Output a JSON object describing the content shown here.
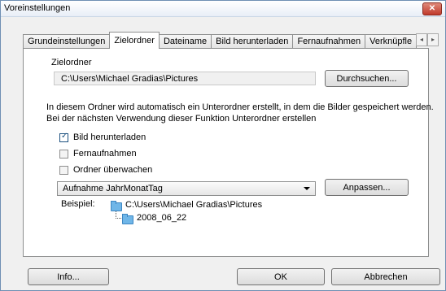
{
  "window": {
    "title": "Voreinstellungen",
    "close_glyph": "✕"
  },
  "tabs": [
    {
      "label": "Grundeinstellungen"
    },
    {
      "label": "Zielordner",
      "active": true
    },
    {
      "label": "Dateiname"
    },
    {
      "label": "Bild herunterladen"
    },
    {
      "label": "Fernaufnahmen"
    },
    {
      "label": "Verknüpfle"
    }
  ],
  "tab_scroll": {
    "left": "◂",
    "right": "▸"
  },
  "target": {
    "section_label": "Zielordner",
    "path": "C:\\Users\\Michael Gradias\\Pictures",
    "browse_label": "Durchsuchen..."
  },
  "description": {
    "line1": "In diesem Ordner wird automatisch ein Unterordner erstellt, in dem die Bilder gespeichert werden.",
    "line2": "Bei der nächsten Verwendung dieser Funktion Unterordner erstellen"
  },
  "options": [
    {
      "label": "Bild herunterladen",
      "checked": true
    },
    {
      "label": "Fernaufnahmen",
      "checked": false
    },
    {
      "label": "Ordner überwachen",
      "checked": false
    }
  ],
  "subfolder": {
    "selected": "Aufnahme JahrMonatTag",
    "customize_label": "Anpassen..."
  },
  "example": {
    "label": "Beispiel:",
    "root": "C:\\Users\\Michael Gradias\\Pictures",
    "child": "2008_06_22"
  },
  "footer": {
    "info_label": "Info...",
    "ok_label": "OK",
    "cancel_label": "Abbrechen"
  }
}
